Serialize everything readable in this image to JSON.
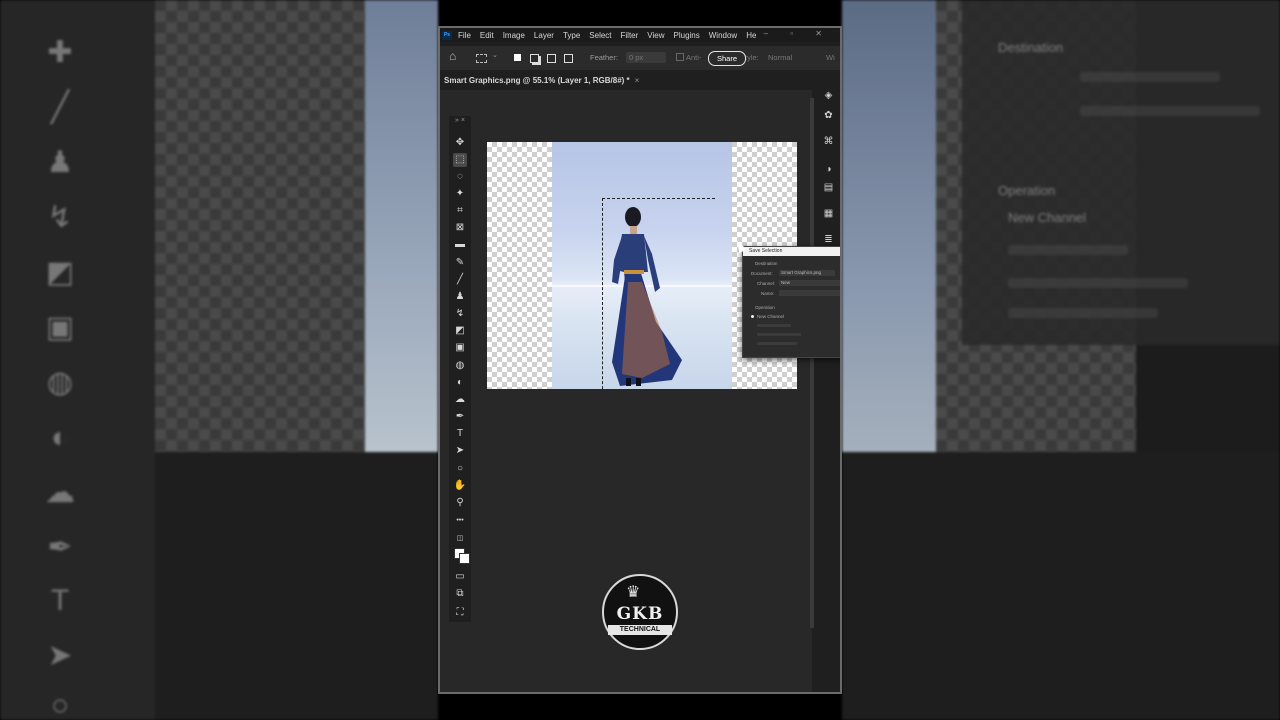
{
  "app": {
    "name": "Photoshop",
    "logo_text": "Ps",
    "window_controls": "– ▫ ✕"
  },
  "menubar": {
    "items": [
      "File",
      "Edit",
      "Image",
      "Layer",
      "Type",
      "Select",
      "Filter",
      "View",
      "Plugins",
      "Window",
      "He"
    ]
  },
  "options_bar": {
    "feather_label": "Feather:",
    "feather_value": "0 px",
    "antialias_label": "Anti-",
    "share_label": "Share",
    "style_label": "Style:",
    "style_value": "Normal",
    "width_label": "Wi"
  },
  "document": {
    "tab_title": "Smart Graphics.png @ 55.1% (Layer 1, RGB/8#) *",
    "tab_close": "×"
  },
  "toolbar": {
    "header": "» ×",
    "tools": [
      {
        "name": "move-tool",
        "glyph": "✥"
      },
      {
        "name": "rectangular-marquee-tool",
        "glyph": "⬚"
      },
      {
        "name": "lasso-tool",
        "glyph": "◌"
      },
      {
        "name": "magic-wand-tool",
        "glyph": "✦"
      },
      {
        "name": "crop-tool",
        "glyph": "⌗"
      },
      {
        "name": "frame-tool",
        "glyph": "⊠"
      },
      {
        "name": "ruler-tool",
        "glyph": "▬"
      },
      {
        "name": "spot-healing-tool",
        "glyph": "✎"
      },
      {
        "name": "brush-tool",
        "glyph": "╱"
      },
      {
        "name": "clone-stamp-tool",
        "glyph": "♟"
      },
      {
        "name": "history-brush-tool",
        "glyph": "↯"
      },
      {
        "name": "eraser-tool",
        "glyph": "◩"
      },
      {
        "name": "gradient-tool",
        "glyph": "▣"
      },
      {
        "name": "blur-tool",
        "glyph": "◍"
      },
      {
        "name": "dodge-tool",
        "glyph": "◐"
      },
      {
        "name": "smudge-tool",
        "glyph": "☁"
      },
      {
        "name": "pen-tool",
        "glyph": "✒"
      },
      {
        "name": "type-tool",
        "glyph": "T"
      },
      {
        "name": "path-selection-tool",
        "glyph": "➤"
      },
      {
        "name": "ellipse-tool",
        "glyph": "○"
      },
      {
        "name": "hand-tool",
        "glyph": "✋"
      },
      {
        "name": "zoom-tool",
        "glyph": "⚲"
      },
      {
        "name": "more-tools",
        "glyph": "•••"
      }
    ]
  },
  "save_selection_dialog": {
    "title": "Save Selection",
    "destination_heading": "Destination",
    "document_label": "Document:",
    "document_value": "Smart Graphics.png",
    "channel_label": "Channel:",
    "channel_value": "New",
    "name_label": "Name:",
    "operation_heading": "Operation",
    "operation_option": "New Channel"
  },
  "watermark": {
    "big_text": "GKB",
    "small_text": "TECHNICAL"
  }
}
